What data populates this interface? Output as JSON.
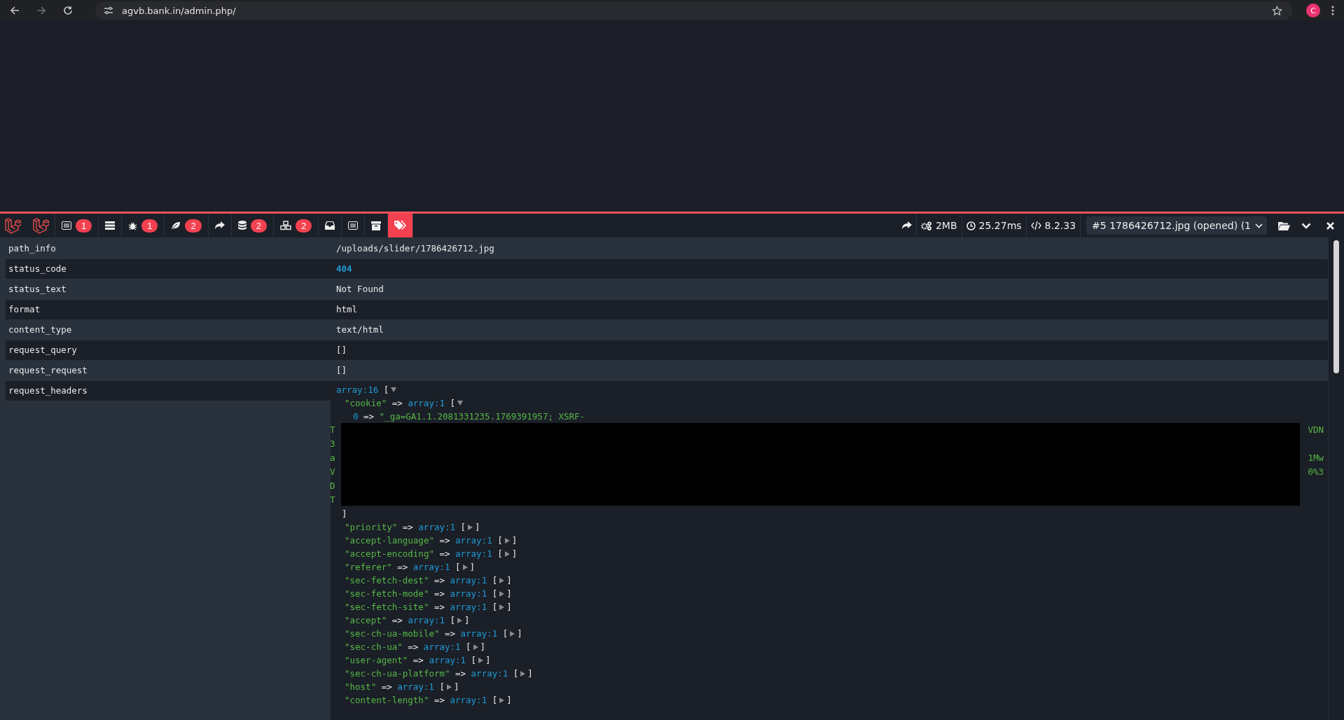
{
  "browser": {
    "url": "agvb.bank.in/admin.php/",
    "profile_initial": "C"
  },
  "toolbar": {
    "tabs": [
      {
        "kind": "messages",
        "badge": "1",
        "selected": false
      },
      {
        "kind": "timeline",
        "selected": false
      },
      {
        "kind": "exceptions",
        "badge": "1",
        "selected": false
      },
      {
        "kind": "views",
        "badge": "2",
        "selected": false
      },
      {
        "kind": "route",
        "selected": false
      },
      {
        "kind": "queries",
        "badge": "2",
        "selected": false
      },
      {
        "kind": "models",
        "badge": "2",
        "selected": false
      },
      {
        "kind": "mails",
        "selected": false
      },
      {
        "kind": "request",
        "selected": false
      },
      {
        "kind": "session",
        "selected": false
      },
      {
        "kind": "tags",
        "selected": true
      }
    ],
    "stats": [
      {
        "kind": "redirect"
      },
      {
        "kind": "memory",
        "text": "2MB"
      },
      {
        "kind": "time",
        "text": "25.27ms"
      },
      {
        "kind": "php",
        "text": "8.2.33"
      }
    ],
    "request_select": "#5 1786426712.jpg (opened) (1"
  },
  "rows": [
    {
      "key": "path_info",
      "kind": "text",
      "value": "/uploads/slider/1786426712.jpg"
    },
    {
      "key": "status_code",
      "kind": "number",
      "value": "404"
    },
    {
      "key": "status_text",
      "kind": "text",
      "value": "Not Found"
    },
    {
      "key": "format",
      "kind": "text",
      "value": "html"
    },
    {
      "key": "content_type",
      "kind": "text",
      "value": "text/html"
    },
    {
      "key": "request_query",
      "kind": "text",
      "value": "[]"
    },
    {
      "key": "request_request",
      "kind": "text",
      "value": "[]"
    },
    {
      "key": "request_headers",
      "kind": "dump"
    }
  ],
  "dump": {
    "type": "array:16",
    "open": "[",
    "expanded": true,
    "children": [
      {
        "key": "\"cookie\"",
        "op": "=>",
        "type": "array:1",
        "open": "[",
        "close": "]",
        "expanded": true,
        "children": [
          {
            "key": "0",
            "op": "=>",
            "value": "\"_ga=GA1.1.2081331235.1769391957; XSRF-",
            "wrapped": [
              {
                "start": "T",
                "end": "VDN"
              },
              {
                "start": "3"
              },
              {
                "start": "a",
                "end": "1Mw"
              },
              {
                "start": "V",
                "end": "0%3"
              },
              {
                "start": "D"
              },
              {
                "start": "T"
              }
            ]
          }
        ]
      },
      {
        "key": "\"priority\"",
        "op": "=>",
        "type": "array:1",
        "open": "[",
        "close": "]",
        "expanded": false
      },
      {
        "key": "\"accept-language\"",
        "op": "=>",
        "type": "array:1",
        "open": "[",
        "close": "]",
        "expanded": false
      },
      {
        "key": "\"accept-encoding\"",
        "op": "=>",
        "type": "array:1",
        "open": "[",
        "close": "]",
        "expanded": false
      },
      {
        "key": "\"referer\"",
        "op": "=>",
        "type": "array:1",
        "open": "[",
        "close": "]",
        "expanded": false
      },
      {
        "key": "\"sec-fetch-dest\"",
        "op": "=>",
        "type": "array:1",
        "open": "[",
        "close": "]",
        "expanded": false
      },
      {
        "key": "\"sec-fetch-mode\"",
        "op": "=>",
        "type": "array:1",
        "open": "[",
        "close": "]",
        "expanded": false
      },
      {
        "key": "\"sec-fetch-site\"",
        "op": "=>",
        "type": "array:1",
        "open": "[",
        "close": "]",
        "expanded": false
      },
      {
        "key": "\"accept\"",
        "op": "=>",
        "type": "array:1",
        "open": "[",
        "close": "]",
        "expanded": false
      },
      {
        "key": "\"sec-ch-ua-mobile\"",
        "op": "=>",
        "type": "array:1",
        "open": "[",
        "close": "]",
        "expanded": false
      },
      {
        "key": "\"sec-ch-ua\"",
        "op": "=>",
        "type": "array:1",
        "open": "[",
        "close": "]",
        "expanded": false
      },
      {
        "key": "\"user-agent\"",
        "op": "=>",
        "type": "array:1",
        "open": "[",
        "close": "]",
        "expanded": false
      },
      {
        "key": "\"sec-ch-ua-platform\"",
        "op": "=>",
        "type": "array:1",
        "open": "[",
        "close": "]",
        "expanded": false
      },
      {
        "key": "\"host\"",
        "op": "=>",
        "type": "array:1",
        "open": "[",
        "close": "]",
        "expanded": false
      },
      {
        "key": "\"content-length\"",
        "op": "=>",
        "type": "array:1",
        "open": "[",
        "close": "]",
        "expanded": false
      }
    ]
  }
}
